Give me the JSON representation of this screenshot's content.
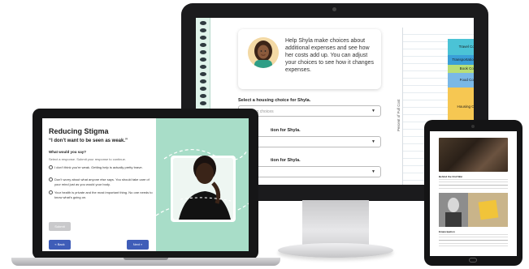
{
  "desktop": {
    "card_text": "Help Shyla make choices about additional expenses and see how her costs add up. You can adjust your choices to see how it changes expenses.",
    "questions": [
      {
        "label": "Select a housing choice for Shyla.",
        "placeholder": "Housing choices"
      },
      {
        "label": "tion for Shyla.",
        "placeholder": ""
      },
      {
        "label": "tion for Shyla.",
        "placeholder": ""
      }
    ],
    "axis_label": "Percent of Full Cost",
    "cost_bars": [
      {
        "label": "Travel Cost",
        "color": "#4bc3d6"
      },
      {
        "label": "Transportation Cost",
        "color": "#3a9fd8"
      },
      {
        "label": "Book Cost",
        "color": "#b9de75"
      },
      {
        "label": "Food Cost",
        "color": "#7ab8e6"
      },
      {
        "label": "Housing Cost",
        "color": "#f6c752"
      }
    ]
  },
  "laptop": {
    "title": "Reducing Stigma",
    "quote": "“I don’t want to be seen as weak.”",
    "ask": "What would you say?",
    "hint": "Select a response. Submit your response to continue.",
    "options": [
      "I don’t think you’re weak. Getting help is actually pretty brave.",
      "Don’t worry about what anyone else says. You should take care of your mind just as you would your body.",
      "Your health is private and the most important thing. No one needs to know what’s going on."
    ],
    "submit_label": "Submit",
    "back_label": "« Back",
    "next_label": "Next »",
    "accent_color": "#3f5db8",
    "panel_color": "#a8ddc8"
  },
  "tablet": {
    "photo_1_caption": "Behind the Civil War",
    "photo_2_caption": "Emancipation"
  }
}
